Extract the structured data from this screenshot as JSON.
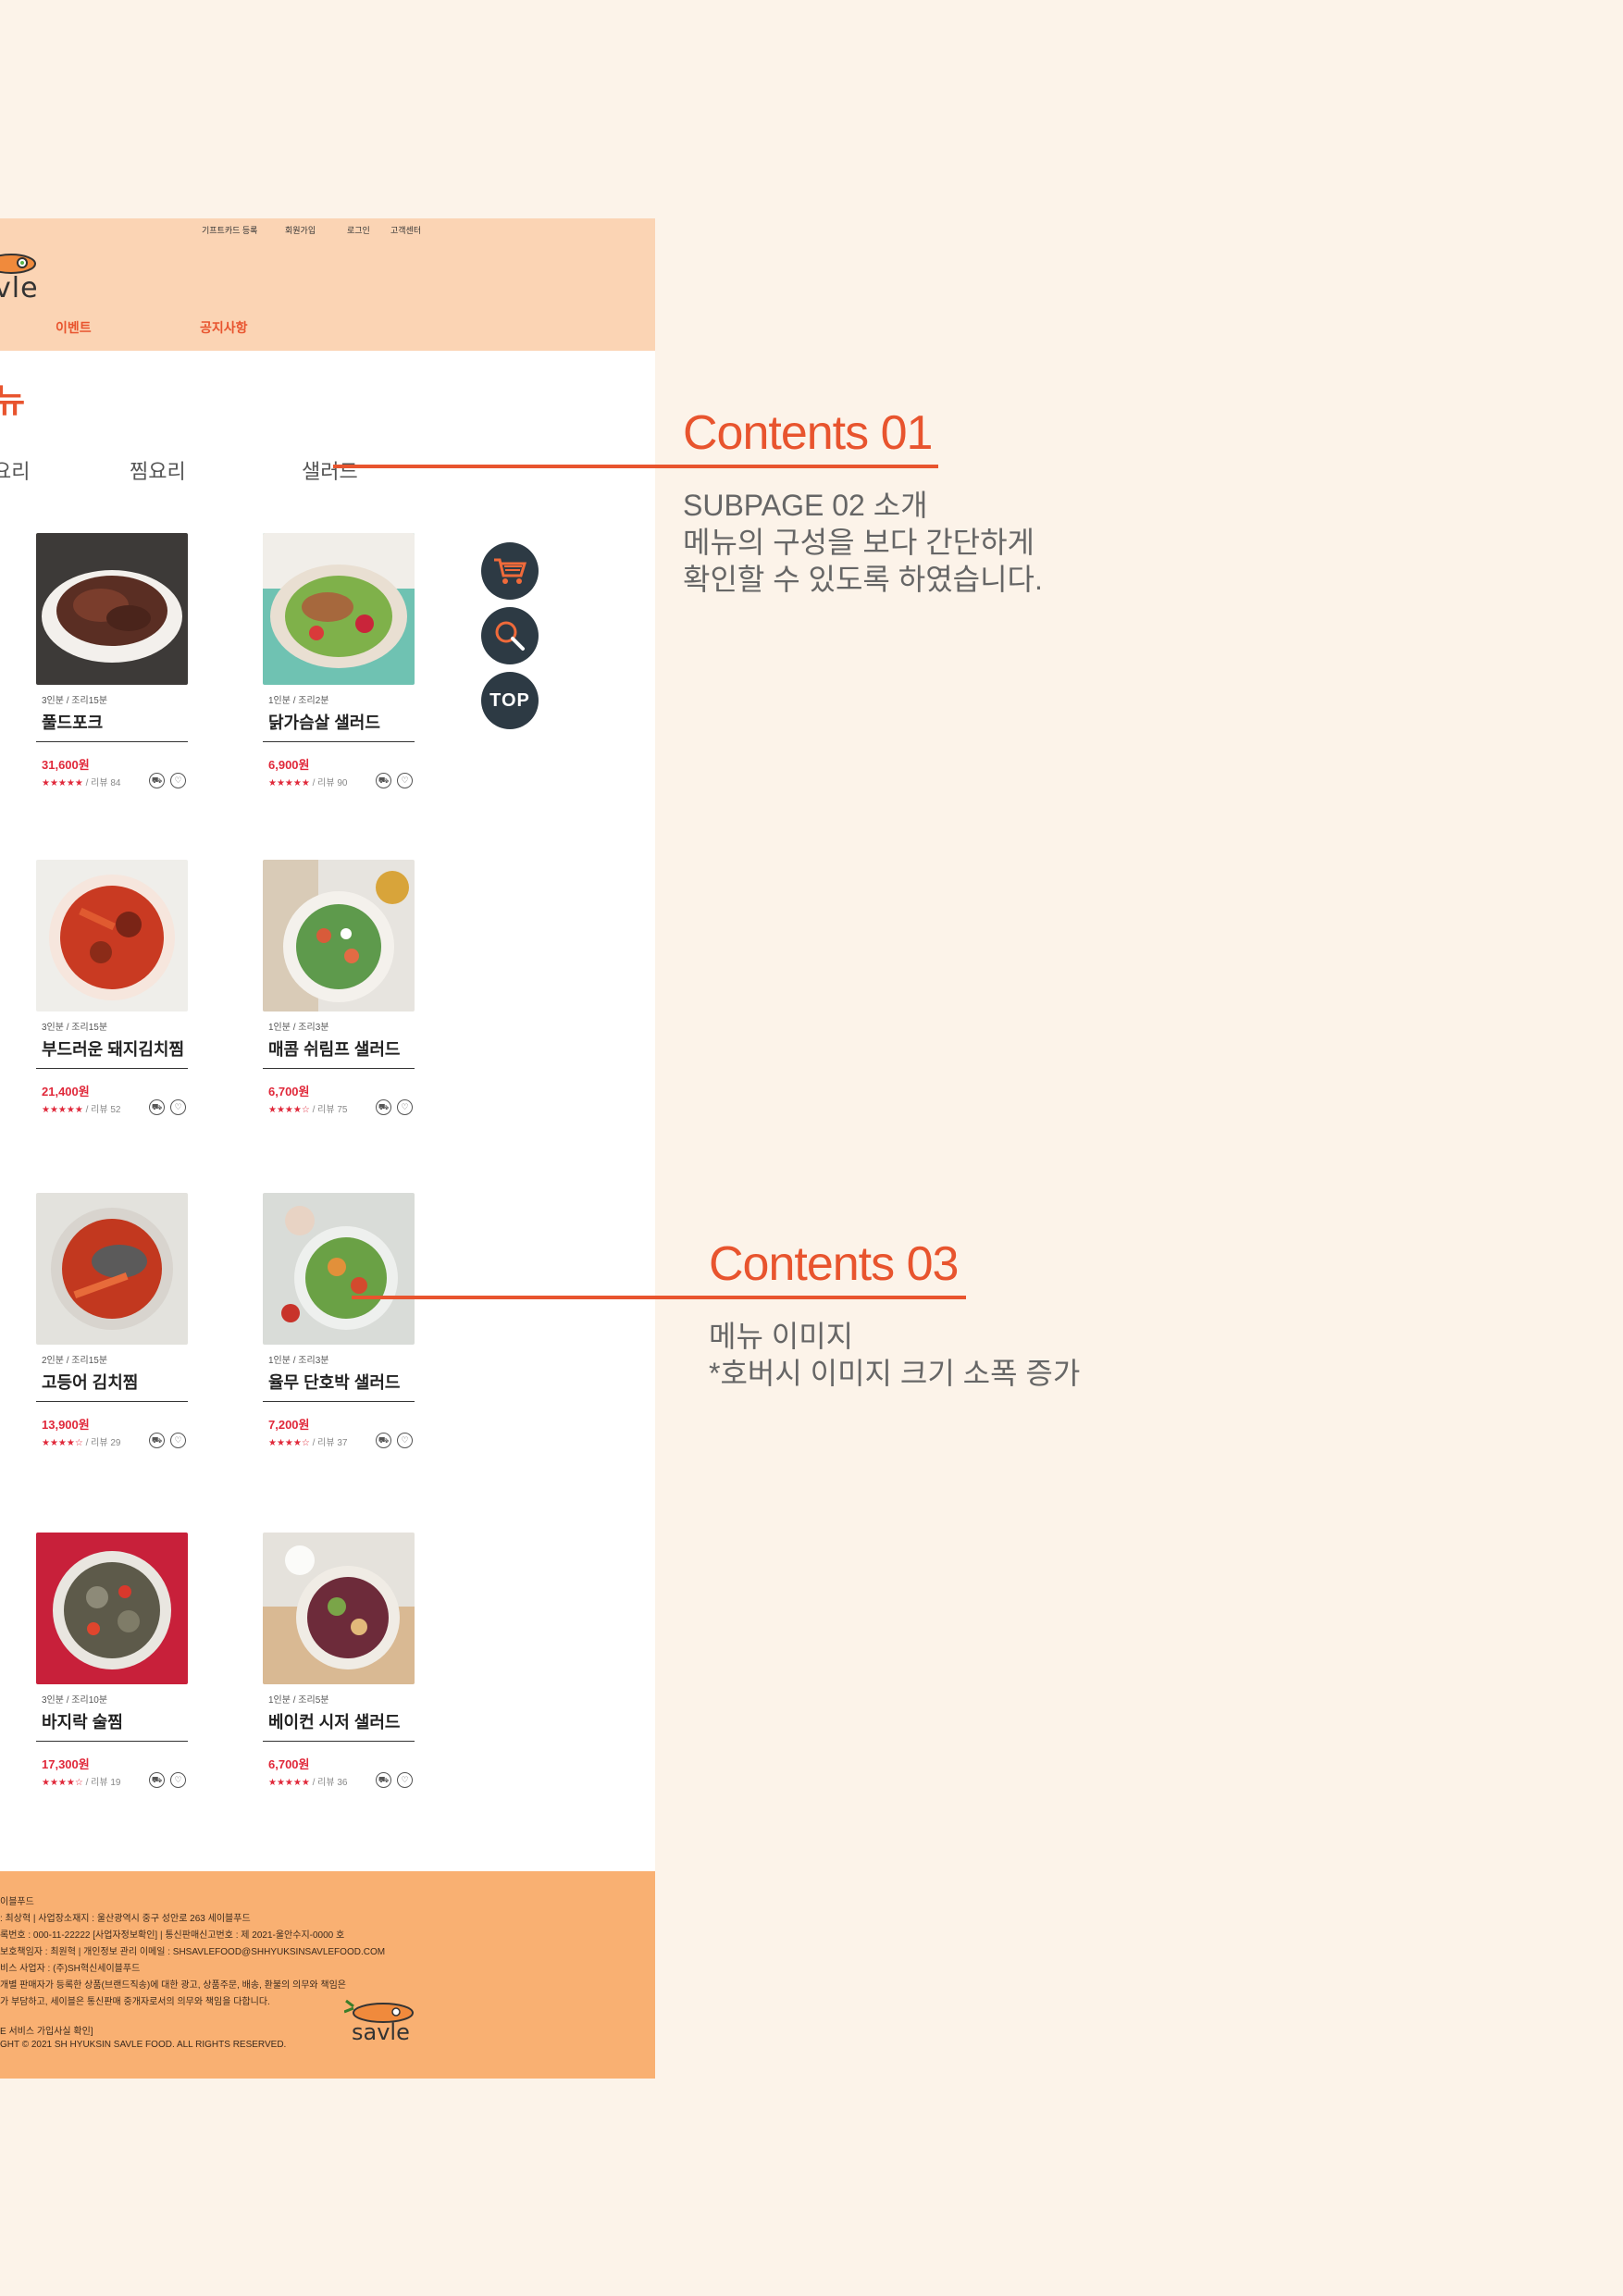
{
  "header": {
    "util_links": [
      "기프트카드 등록",
      "회원가입",
      "로그인",
      "고객센터"
    ],
    "logo_text": "vle",
    "nav": [
      "이벤트",
      "공지사항"
    ]
  },
  "page": {
    "title": "뉴",
    "tabs": [
      "요리",
      "찜요리",
      "샐러드"
    ]
  },
  "products": [
    {
      "meta": "3인분 / 조리15분",
      "name": "풀드포크",
      "price": "31,600원",
      "stars": "★★★★★",
      "reviews": " / 리뷰 84"
    },
    {
      "meta": "1인분 / 조리2분",
      "name": "닭가슴살 샐러드",
      "price": "6,900원",
      "stars": "★★★★★",
      "reviews": " / 리뷰 90"
    },
    {
      "meta": "3인분 / 조리15분",
      "name": "부드러운 돼지김치찜",
      "price": "21,400원",
      "stars": "★★★★★",
      "reviews": " / 리뷰 52"
    },
    {
      "meta": "1인분 / 조리3분",
      "name": "매콤 쉬림프 샐러드",
      "price": "6,700원",
      "stars": "★★★★☆",
      "reviews": " / 리뷰 75"
    },
    {
      "meta": "2인분 / 조리15분",
      "name": "고등어 김치찜",
      "price": "13,900원",
      "stars": "★★★★☆",
      "reviews": " / 리뷰 29"
    },
    {
      "meta": "1인분 / 조리3분",
      "name": "율무 단호박 샐러드",
      "price": "7,200원",
      "stars": "★★★★☆",
      "reviews": " / 리뷰 37"
    },
    {
      "meta": "3인분 / 조리10분",
      "name": "바지락 술찜",
      "price": "17,300원",
      "stars": "★★★★☆",
      "reviews": " / 리뷰 19"
    },
    {
      "meta": "1인분 / 조리5분",
      "name": "베이컨 시저 샐러드",
      "price": "6,700원",
      "stars": "★★★★★",
      "reviews": " / 리뷰 36"
    }
  ],
  "floating": {
    "top_label": "TOP"
  },
  "footer": {
    "lines": [
      "이블푸드",
      ": 최상혁 | 사업장소재지 : 울산광역시 중구 성안로 263 세이블푸드",
      "록번호 : 000-11-22222 [사업자정보확인] | 통신판매신고번호 : 제 2021-울안수지-0000 호",
      "보호책임자 : 최원혁 | 개인정보 관리 이메일 : SHSAVLEFOOD@SHHYUKSINSAVLEFOOD.COM",
      "비스 사업자 : (주)SH혁신세이블푸드",
      "개별 판매자가 등록한 상품(브랜드직송)에 대한 광고, 상품주문, 배송, 환불의 의무와 책임은",
      "가 부담하고, 세이블은 통신판매 중개자로서의 의무와 책임을 다합니다.",
      "",
      "E 서비스 가입사실 확인]",
      "GHT © 2021 SH HYUKSIN SAVLE FOOD. ALL RIGHTS RESERVED."
    ],
    "logo_text": "savle"
  },
  "annotations": [
    {
      "title": "Contents 01",
      "desc": [
        "SUBPAGE 02 소개",
        "메뉴의 구성을 보다 간단하게",
        "확인할 수 있도록 하였습니다."
      ]
    },
    {
      "title": "Contents 03",
      "desc": [
        "메뉴 이미지",
        "*호버시 이미지 크기 소폭 증가"
      ]
    }
  ],
  "colors": {
    "accent": "#e8542e",
    "header_bg": "#fbd4b4",
    "footer_bg": "#f9b072",
    "page_bg": "#fcf3e9",
    "price": "#e0283a"
  }
}
